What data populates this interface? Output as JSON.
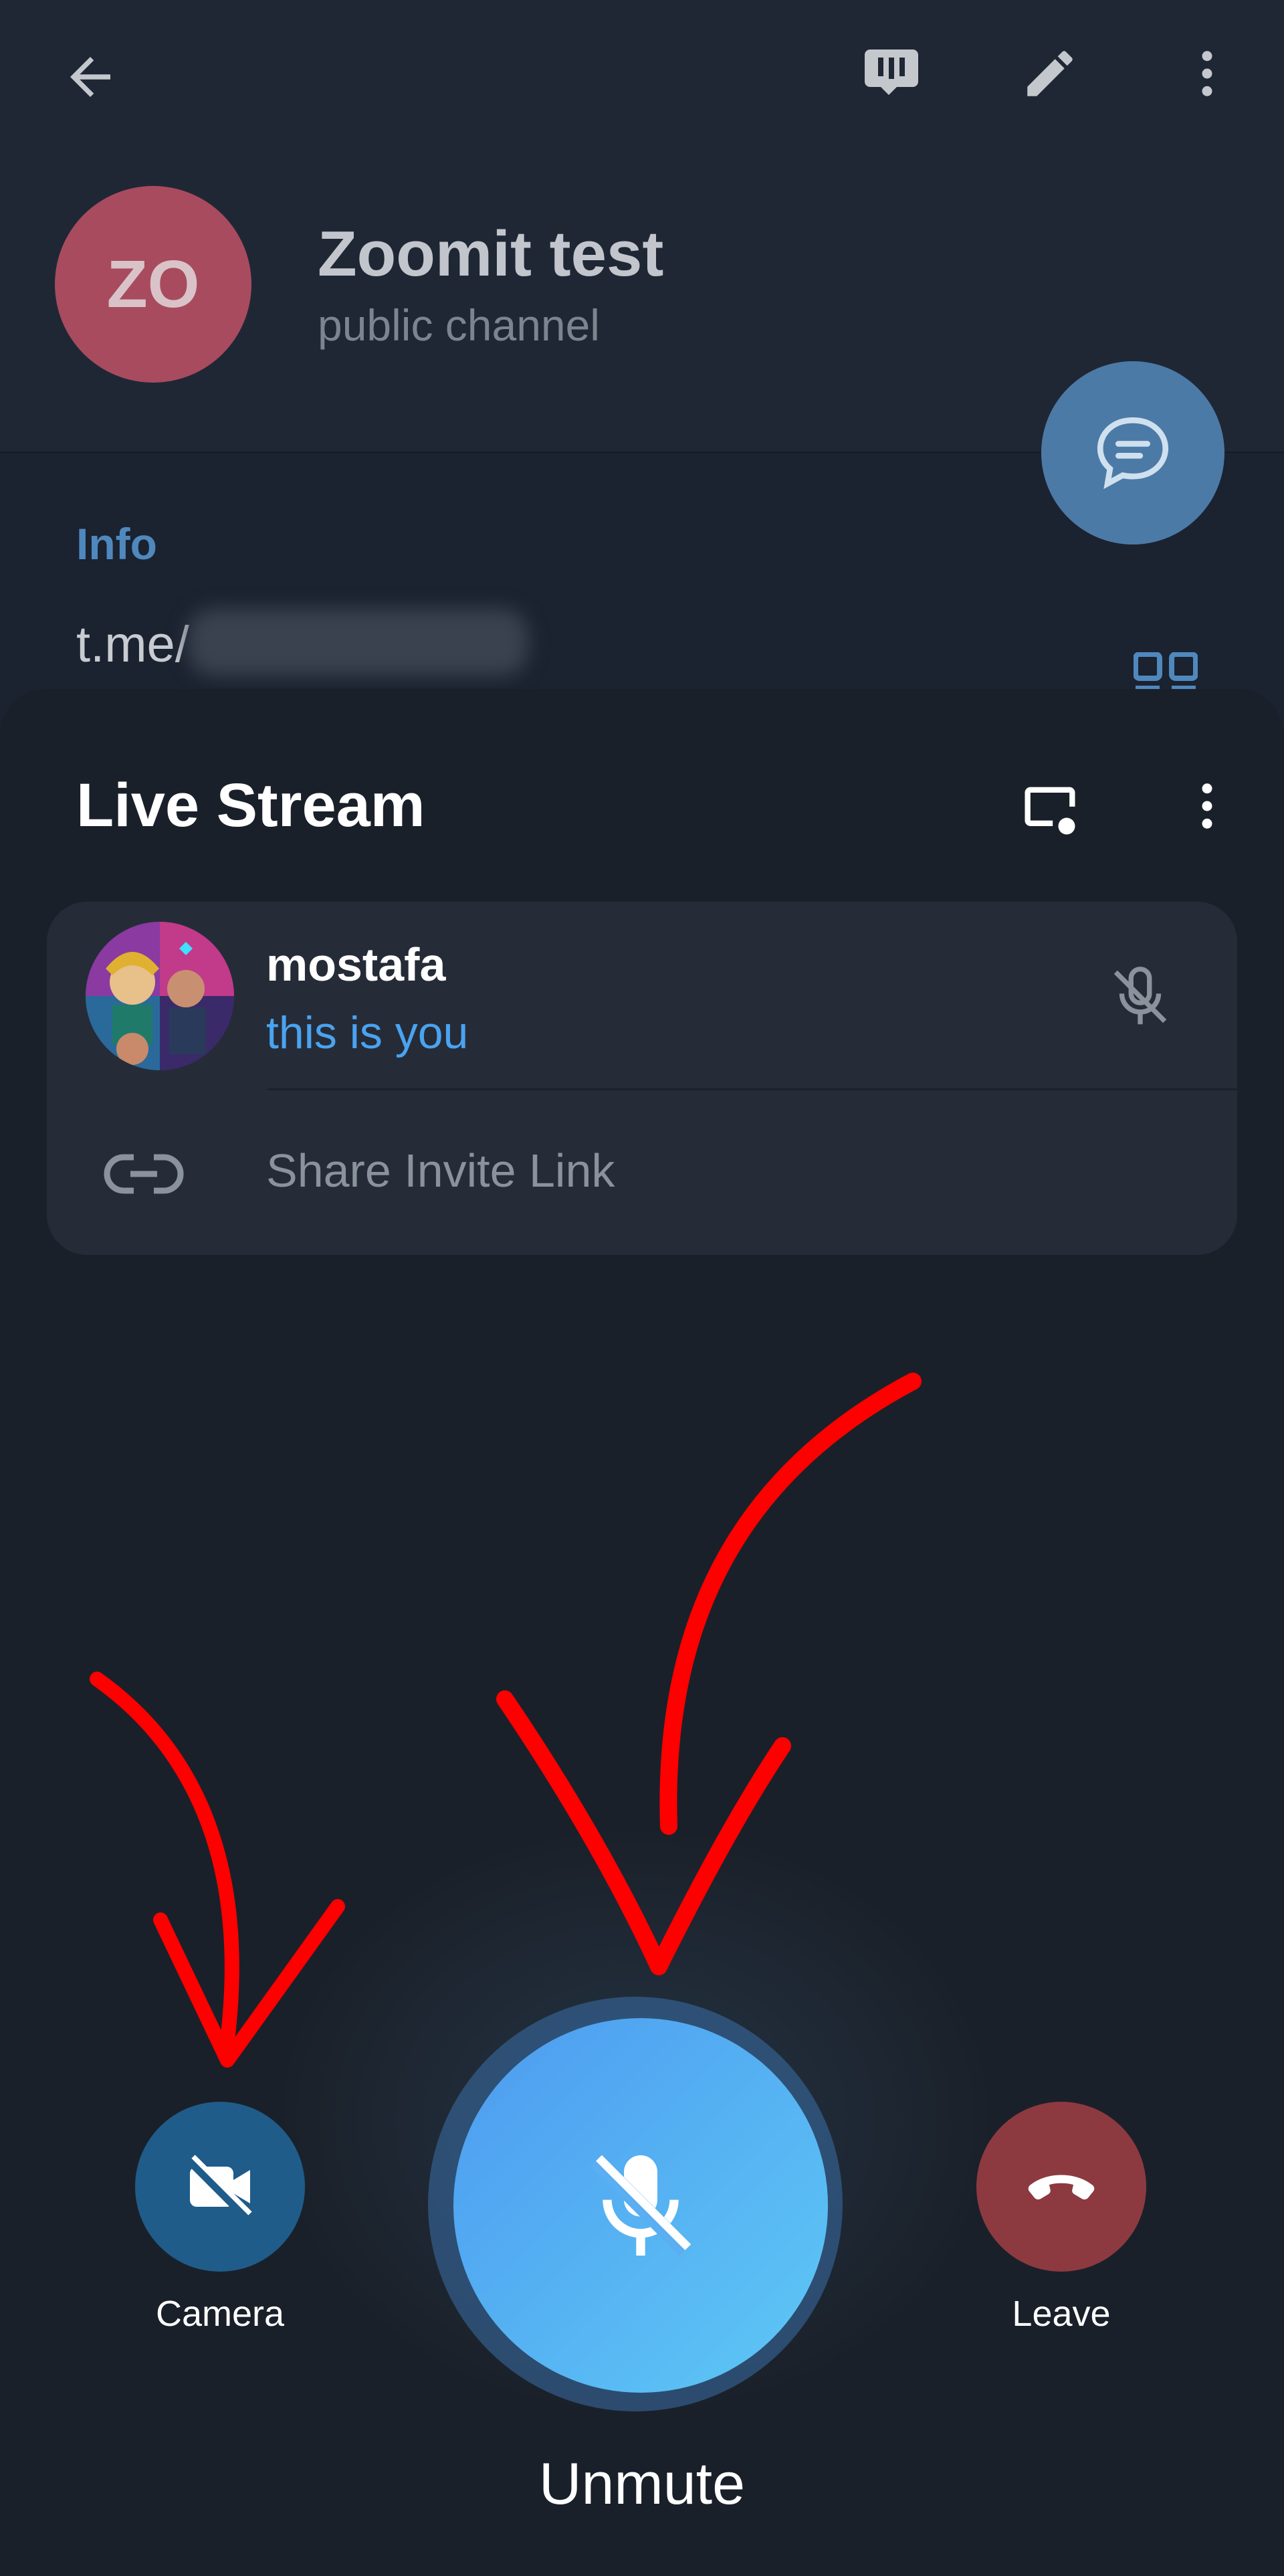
{
  "channel": {
    "avatar_initials": "ZO",
    "title": "Zoomit test",
    "subtitle": "public channel",
    "info_label": "Info",
    "link_prefix": "t.me/"
  },
  "toolbar": {
    "icons": [
      "back-arrow-icon",
      "live-stream-icon",
      "edit-pencil-icon",
      "more-vertical-icon"
    ]
  },
  "sheet": {
    "title": "Live Stream",
    "participant": {
      "name": "mostafa",
      "status": "this is you"
    },
    "share_invite_label": "Share Invite Link"
  },
  "controls": {
    "camera_label": "Camera",
    "unmute_label": "Unmute",
    "leave_label": "Leave"
  },
  "colors": {
    "accent_blue": "#4aa3f0",
    "leave_red": "#8c3a40",
    "camera_blue": "#1f5c8a",
    "annotation_red": "#ff0000"
  }
}
